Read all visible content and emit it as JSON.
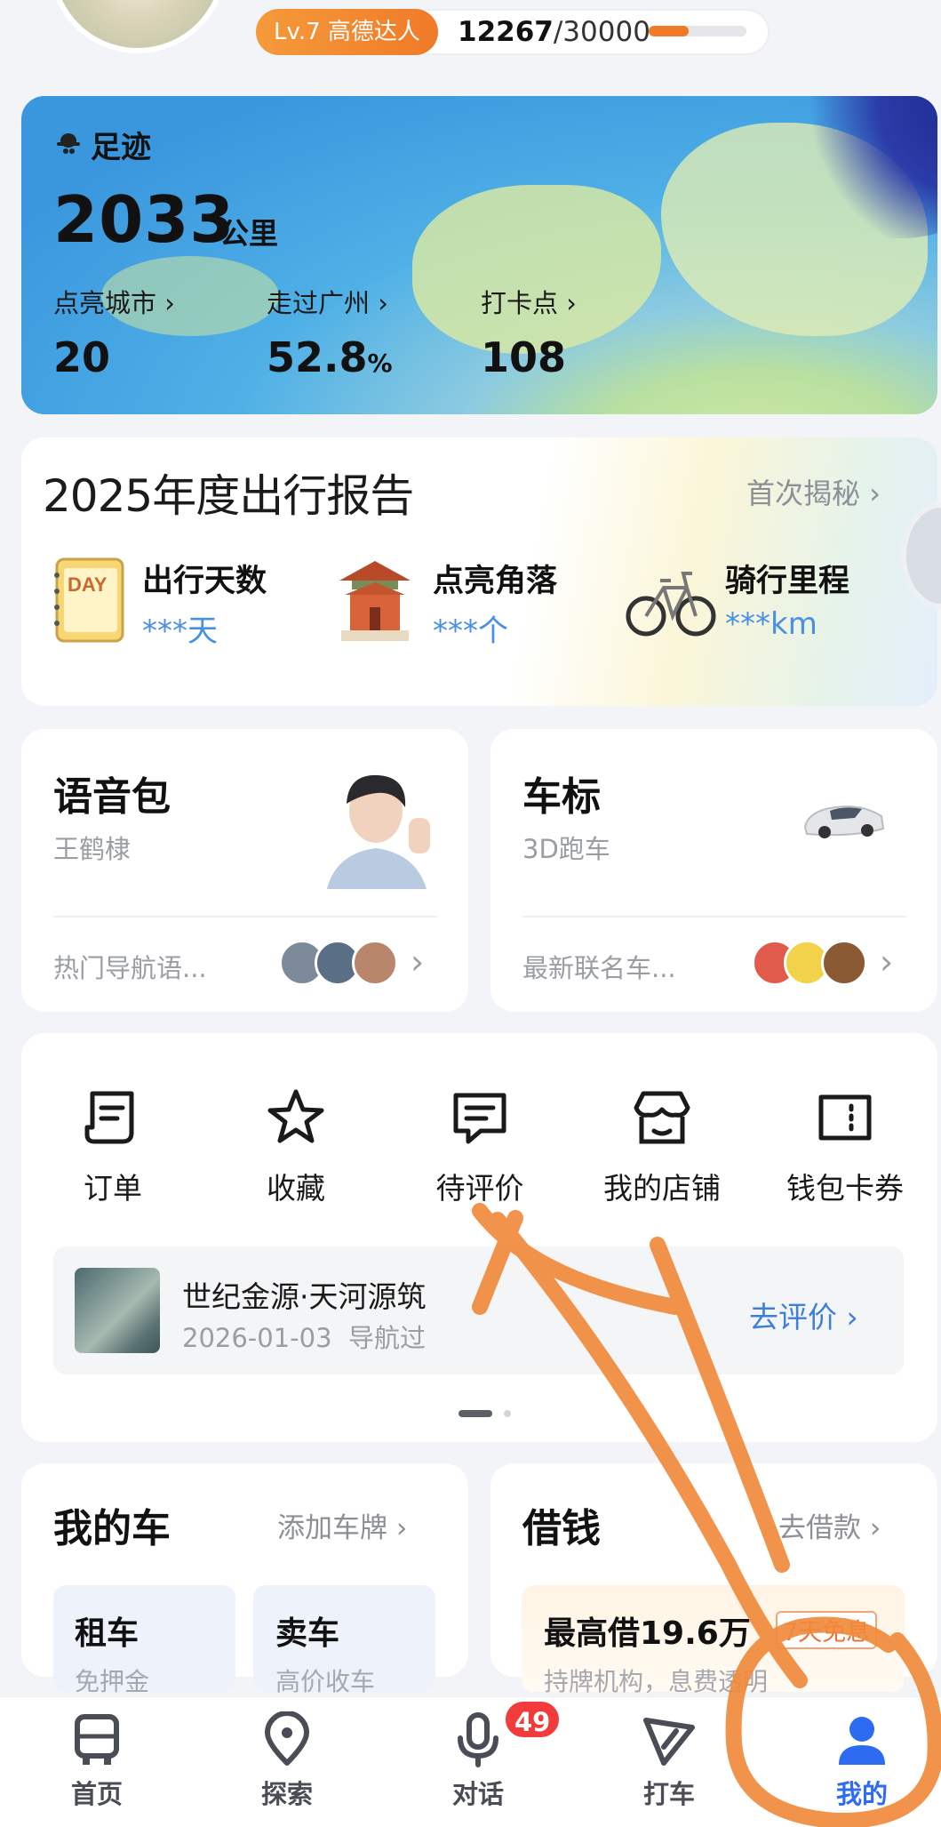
{
  "header": {
    "level_badge": "Lv.7 高德达人",
    "xp_current": "12267",
    "xp_max": "/30000",
    "xp_progress": 0.41
  },
  "footprint": {
    "title": "足迹",
    "total": "2033",
    "unit": "公里",
    "stats": [
      {
        "label": "点亮城市",
        "value": "20",
        "suffix": ""
      },
      {
        "label": "走过广州",
        "value": "52.8",
        "suffix": "%"
      },
      {
        "label": "打卡点",
        "value": "108",
        "suffix": ""
      }
    ]
  },
  "report": {
    "title": "2025年度出行报告",
    "link": "首次揭秘",
    "items": [
      {
        "title": "出行天数",
        "value": "***天",
        "icon": "calendar-day-icon",
        "icon_text": "DAY"
      },
      {
        "title": "点亮角落",
        "value": "***个",
        "icon": "pavilion-icon"
      },
      {
        "title": "骑行里程",
        "value": "***km",
        "icon": "bicycle-icon"
      }
    ]
  },
  "voice_pack": {
    "title": "语音包",
    "subtitle": "王鹤棣",
    "footer": "热门导航语..."
  },
  "car_marker": {
    "title": "车标",
    "subtitle": "3D跑车",
    "footer": "最新联名车..."
  },
  "quick_actions": [
    {
      "label": "订单",
      "icon": "order-icon"
    },
    {
      "label": "收藏",
      "icon": "star-icon"
    },
    {
      "label": "待评价",
      "icon": "review-icon"
    },
    {
      "label": "我的店铺",
      "icon": "shop-icon"
    },
    {
      "label": "钱包卡券",
      "icon": "ticket-icon"
    }
  ],
  "pending_review": {
    "place": "世纪金源·天河源筑",
    "date": "2026-01-03",
    "action": "导航过",
    "button": "去评价"
  },
  "my_car": {
    "title": "我的车",
    "link": "添加车牌",
    "tiles": [
      {
        "title": "租车",
        "sub": "免押金"
      },
      {
        "title": "卖车",
        "sub": "高价收车"
      }
    ]
  },
  "loan": {
    "title": "借钱",
    "link": "去借款",
    "tile_title": "最高借19.6万",
    "tile_tag": "7天免息",
    "tile_sub": "持牌机构，息费透明"
  },
  "tabbar": {
    "tabs": [
      {
        "label": "首页",
        "icon": "bus-icon"
      },
      {
        "label": "探索",
        "icon": "location-pin-icon"
      },
      {
        "label": "对话",
        "icon": "microphone-icon"
      },
      {
        "label": "打车",
        "icon": "taxi-arrow-icon"
      },
      {
        "label": "我的",
        "icon": "user-icon"
      }
    ],
    "badge": "49",
    "active": "我的"
  },
  "colors": {
    "accent_orange": "#f07a28",
    "link_blue": "#3d7fd9",
    "active_tab": "#2d6cf0",
    "badge_red": "#f23b3b",
    "annotation": "#f08a3c"
  }
}
